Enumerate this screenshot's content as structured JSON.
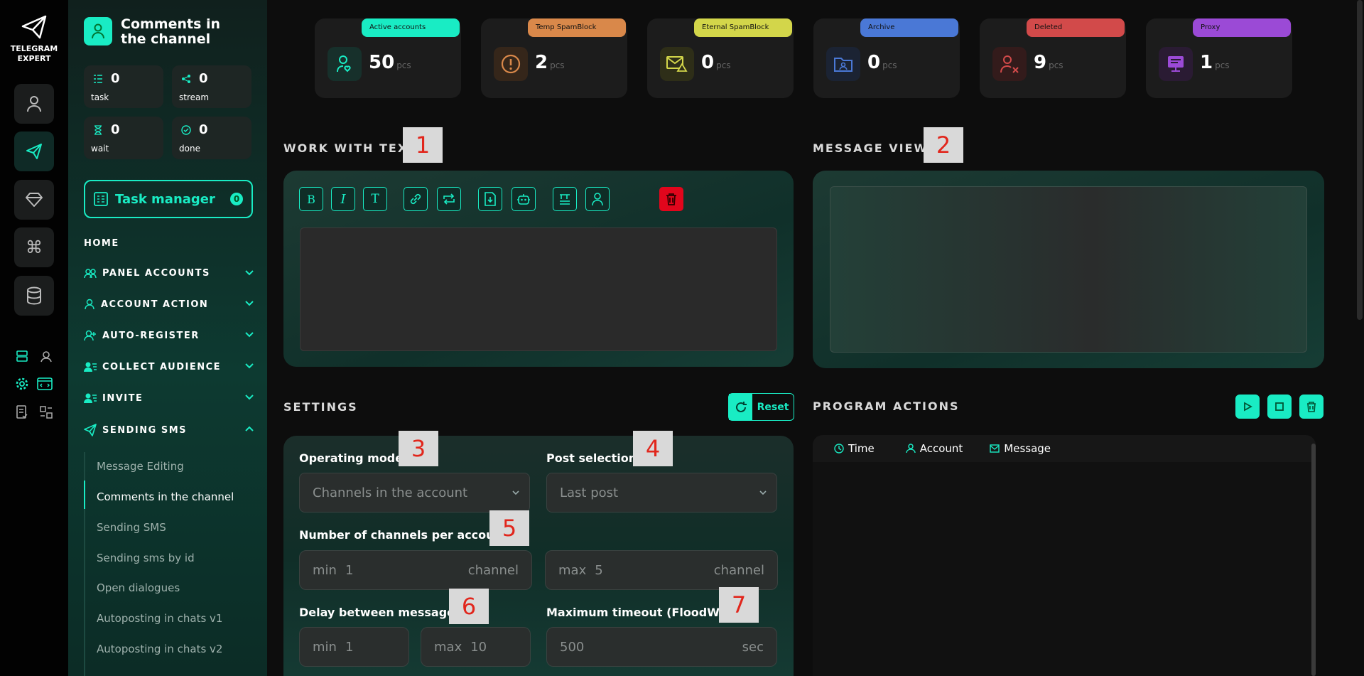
{
  "app": {
    "name_line1": "TELEGRAM",
    "name_line2": "EXPERT"
  },
  "page": {
    "title": "Comments in the channel"
  },
  "stats": [
    {
      "value": "0",
      "label": "task",
      "icon": "list-icon"
    },
    {
      "value": "0",
      "label": "stream",
      "icon": "share-icon"
    },
    {
      "value": "0",
      "label": "wait",
      "icon": "hourglass-icon"
    },
    {
      "value": "0",
      "label": "done",
      "icon": "check-circle-icon"
    }
  ],
  "task_manager": {
    "label": "Task manager",
    "count": "0"
  },
  "nav": {
    "home": "HOME",
    "items": [
      {
        "label": "PANEL ACCOUNTS"
      },
      {
        "label": "ACCOUNT ACTION"
      },
      {
        "label": "AUTO-REGISTER"
      },
      {
        "label": "COLLECT AUDIENCE"
      },
      {
        "label": "INVITE"
      },
      {
        "label": "SENDING SMS"
      }
    ],
    "sub_items": [
      {
        "label": "Message Editing"
      },
      {
        "label": "Comments in the channel"
      },
      {
        "label": "Sending SMS"
      },
      {
        "label": "Sending sms by id"
      },
      {
        "label": "Open dialogues"
      },
      {
        "label": "Autoposting in chats v1"
      },
      {
        "label": "Autoposting in chats v2"
      }
    ]
  },
  "cards": [
    {
      "tag": "Active accounts",
      "value": "50",
      "unit": "pcs",
      "color": "#19ecc4"
    },
    {
      "tag": "Temp SpamBlock",
      "value": "2",
      "unit": "pcs",
      "color": "#d9884a"
    },
    {
      "tag": "Eternal SpamBlock",
      "value": "0",
      "unit": "pcs",
      "color": "#d3d64a"
    },
    {
      "tag": "Archive",
      "value": "0",
      "unit": "pcs",
      "color": "#4a78d6"
    },
    {
      "tag": "Deleted",
      "value": "9",
      "unit": "pcs",
      "color": "#d24a4a"
    },
    {
      "tag": "Proxy",
      "value": "1",
      "unit": "pcs",
      "color": "#9b4ad6"
    }
  ],
  "sections": {
    "work_with_text": "WORK WITH TEXT",
    "message_view": "MESSAGE VIEW",
    "settings": "SETTINGS",
    "program_actions": "PROGRAM ACTIONS"
  },
  "badges": [
    "1",
    "2",
    "3",
    "4",
    "5",
    "6",
    "7"
  ],
  "reset_label": "Reset",
  "settings": {
    "operating_mode": {
      "label": "Operating mode",
      "value": "Channels in the account"
    },
    "post_selection": {
      "label": "Post selection",
      "value": "Last post"
    },
    "channels_per_account": {
      "label": "Number of channels per account",
      "min_pre": "min",
      "min": "1",
      "max_pre": "max",
      "max": "5",
      "unit": "channel"
    },
    "delay": {
      "label": "Delay between messages",
      "min_pre": "min",
      "min": "1",
      "max_pre": "max",
      "max": "10"
    },
    "floodwait": {
      "label": "Maximum timeout (FloodWait)",
      "value": "500",
      "unit": "sec"
    }
  },
  "log": {
    "columns": [
      "Time",
      "Account",
      "Message"
    ]
  },
  "colors": {
    "accent": "#19ecc4",
    "danger": "#e1061c"
  }
}
